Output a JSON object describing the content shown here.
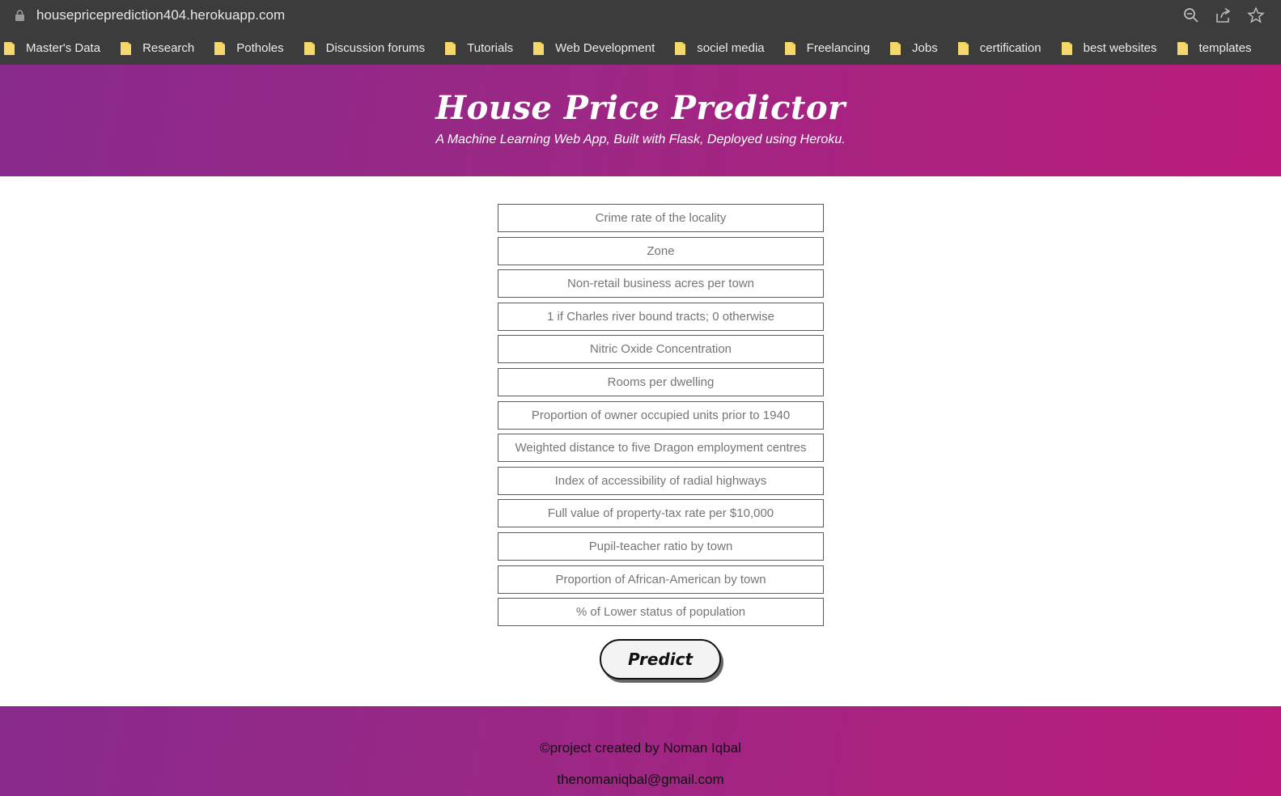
{
  "browser": {
    "url": "housepriceprediction404.herokuapp.com",
    "bookmarks": [
      {
        "label": "Master's Data"
      },
      {
        "label": "Research"
      },
      {
        "label": "Potholes"
      },
      {
        "label": "Discussion forums"
      },
      {
        "label": "Tutorials"
      },
      {
        "label": "Web Development"
      },
      {
        "label": "sociel media"
      },
      {
        "label": "Freelancing"
      },
      {
        "label": "Jobs"
      },
      {
        "label": "certification"
      },
      {
        "label": "best websites"
      },
      {
        "label": "templates"
      }
    ]
  },
  "header": {
    "title": "House Price Predictor",
    "subtitle": "A Machine Learning Web App, Built with Flask, Deployed using Heroku."
  },
  "form": {
    "fields": [
      {
        "placeholder": "Crime rate of the locality"
      },
      {
        "placeholder": "Zone"
      },
      {
        "placeholder": "Non-retail business acres per town"
      },
      {
        "placeholder": "1 if Charles river bound tracts; 0 otherwise"
      },
      {
        "placeholder": "Nitric Oxide Concentration"
      },
      {
        "placeholder": "Rooms per dwelling"
      },
      {
        "placeholder": "Proportion of owner occupied units prior to 1940"
      },
      {
        "placeholder": "Weighted distance to five Dragon employment centres"
      },
      {
        "placeholder": "Index of accessibility of radial highways"
      },
      {
        "placeholder": "Full value of property-tax rate per $10,000"
      },
      {
        "placeholder": "Pupil-teacher ratio by town"
      },
      {
        "placeholder": "Proportion of African-American by town"
      },
      {
        "placeholder": "% of Lower status of population"
      }
    ],
    "submit_label": "Predict"
  },
  "footer": {
    "credit": "©project created by Noman Iqbal",
    "email": "thenomaniqbal@gmail.com"
  },
  "colors": {
    "gradient_start": "#892a8d",
    "gradient_end": "#bb1b7b",
    "chrome": "#3c3c3c",
    "folder": "#f5d86b"
  }
}
